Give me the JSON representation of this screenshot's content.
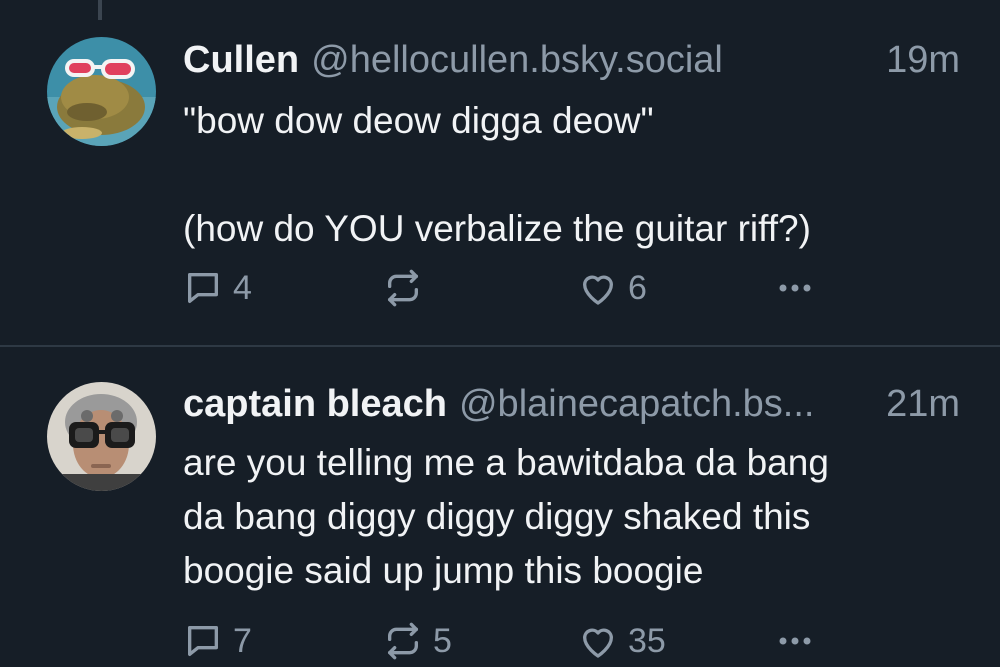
{
  "posts": [
    {
      "display_name": "Cullen",
      "handle": "@hellocullen.bsky.social",
      "timestamp": "19m",
      "text_lines": [
        "\"bow dow deow digga deow\""
      ],
      "text_lines_2": [
        "(how do YOU verbalize the guitar riff?)"
      ],
      "reply_count": "4",
      "repost_count": "",
      "like_count": "6",
      "avatar_icon": "frog-with-sunglasses-avatar"
    },
    {
      "display_name": "captain bleach",
      "handle": "@blainecapatch.bs...",
      "timestamp": "21m",
      "text_lines": [
        "are you telling me a bawitdaba da bang",
        "da bang diggy diggy diggy shaked this",
        "boogie said up jump this boogie"
      ],
      "reply_count": "7",
      "repost_count": "5",
      "like_count": "35",
      "avatar_icon": "man-with-goggles-avatar"
    }
  ],
  "icons": {
    "reply": "reply-icon",
    "repost": "repost-icon",
    "like": "heart-icon",
    "more": "more-options-icon"
  },
  "colors": {
    "background": "#161e27",
    "text": "#f1f3f5",
    "muted": "#8d9aa8",
    "divider": "#2e3944"
  }
}
